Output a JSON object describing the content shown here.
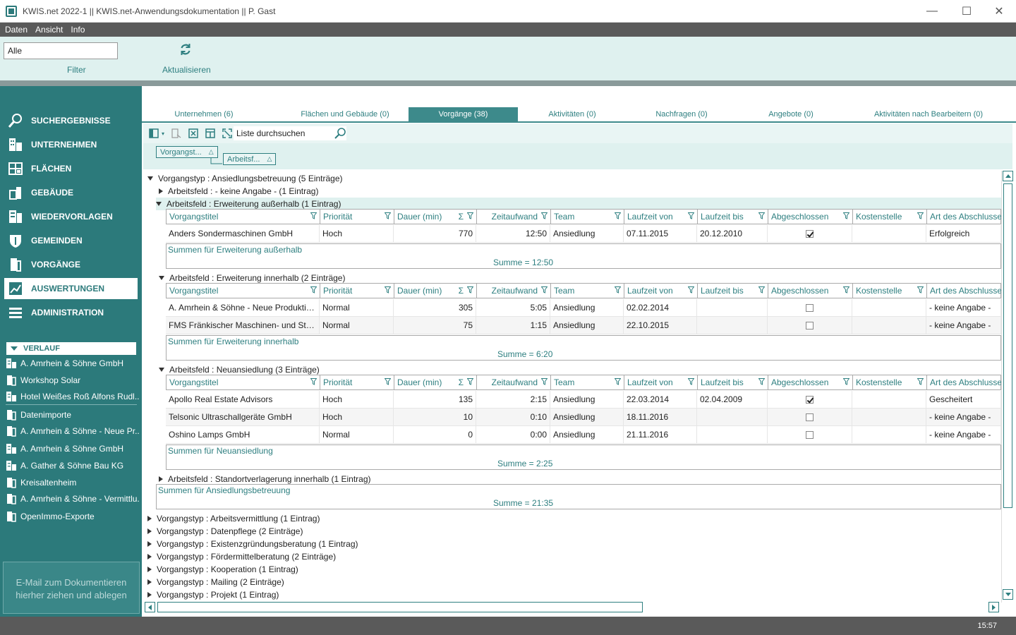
{
  "window": {
    "title": "KWIS.net 2022-1 || KWIS.net-Anwendungsdokumentation || P. Gast"
  },
  "menu": [
    "Daten",
    "Ansicht",
    "Info"
  ],
  "ribbon": {
    "filter_value": "Alle",
    "filter_label": "Filter",
    "refresh_label": "Aktualisieren"
  },
  "nav": [
    {
      "label": "SUCHERGEBNISSE",
      "icon": "search-icon",
      "active": false
    },
    {
      "label": "UNTERNEHMEN",
      "icon": "building-icon",
      "active": false
    },
    {
      "label": "FLÄCHEN",
      "icon": "area-icon",
      "active": false
    },
    {
      "label": "GEBÄUDE",
      "icon": "house-icon",
      "active": false
    },
    {
      "label": "WIEDERVORLAGEN",
      "icon": "calendar-icon",
      "active": false
    },
    {
      "label": "GEMEINDEN",
      "icon": "shield-icon",
      "active": false
    },
    {
      "label": "VORGÄNGE",
      "icon": "folder-icon",
      "active": false
    },
    {
      "label": "AUSWERTUNGEN",
      "icon": "chart-icon",
      "active": true
    },
    {
      "label": "ADMINISTRATION",
      "icon": "settings-icon",
      "active": false
    }
  ],
  "verlauf": {
    "title": "VERLAUF",
    "items": [
      {
        "label": "A. Amrhein & Söhne GmbH",
        "icon": "building-icon"
      },
      {
        "label": "Workshop Solar",
        "icon": "folder-icon"
      },
      {
        "label": "Hotel Weißes Roß Alfons Rudl...",
        "icon": "building-icon"
      },
      {
        "label": "Datenimporte",
        "icon": "folder-icon"
      },
      {
        "label": "A. Amrhein & Söhne - Neue Pr...",
        "icon": "folder-icon"
      },
      {
        "label": "A. Amrhein & Söhne GmbH",
        "icon": "building-icon"
      },
      {
        "label": "A. Gather & Söhne Bau KG",
        "icon": "building-icon"
      },
      {
        "label": "Kreisaltenheim",
        "icon": "folder-icon"
      },
      {
        "label": "A. Amrhein & Söhne - Vermittlu...",
        "icon": "folder-icon"
      },
      {
        "label": "OpenImmo-Exporte",
        "icon": "folder-icon"
      }
    ]
  },
  "dropzone": {
    "line1": "E-Mail  zum Dokumentieren",
    "line2": "hierher ziehen und ablegen"
  },
  "tabs": [
    {
      "label": "Unternehmen (6)"
    },
    {
      "label": "Flächen und Gebäude (0)"
    },
    {
      "label": "Vorgänge (38)"
    },
    {
      "label": "Aktivitäten (0)"
    },
    {
      "label": "Nachfragen (0)"
    },
    {
      "label": "Angebote (0)"
    },
    {
      "label": "Aktivitäten nach Bearbeitern (0)"
    }
  ],
  "active_tab": 2,
  "toolbar": {
    "search_placeholder": "Liste durchsuchen"
  },
  "groupby": [
    "Vorgangst...",
    "Arbeitsf..."
  ],
  "columns": [
    "Vorgangstitel",
    "Priorität",
    "Dauer (min)",
    "Zeitaufwand",
    "Team",
    "Laufzeit von",
    "Laufzeit bis",
    "Abgeschlossen",
    "Kostenstelle",
    "Art des Abschlusses"
  ],
  "grid": {
    "group1": "Vorgangstyp : Ansiedlungsbetreuung (5 Einträge)",
    "sub1": "Arbeitsfeld : - keine Angabe - (1 Eintrag)",
    "sub2": "Arbeitsfeld : Erweiterung außerhalb (1 Eintrag)",
    "sub2_rows": [
      [
        "Anders Sondermaschinen GmbH",
        "Hoch",
        "770",
        "12:50",
        "Ansiedlung",
        "07.11.2015",
        "20.12.2010",
        true,
        "",
        "Erfolgreich"
      ]
    ],
    "sub2_sum_title": "Summen für Erweiterung außerhalb",
    "sub2_sum": "Summe = 12:50",
    "sub3": "Arbeitsfeld : Erweiterung innerhalb (2 Einträge)",
    "sub3_rows": [
      [
        "A. Amrhein & Söhne - Neue Produktionshalle",
        "Normal",
        "305",
        "5:05",
        "Ansiedlung",
        "02.02.2014",
        "",
        false,
        "",
        "- keine Angabe -"
      ],
      [
        "FMS Fränkischer Maschinen- und Stahlbau",
        "Normal",
        "75",
        "1:15",
        "Ansiedlung",
        "22.10.2015",
        "",
        false,
        "",
        "- keine Angabe -"
      ]
    ],
    "sub3_sum_title": "Summen für Erweiterung innerhalb",
    "sub3_sum": "Summe = 6:20",
    "sub4": "Arbeitsfeld : Neuansiedlung (3 Einträge)",
    "sub4_rows": [
      [
        "Apollo Real Estate Advisors",
        "Hoch",
        "135",
        "2:15",
        "Ansiedlung",
        "22.03.2014",
        "02.04.2009",
        true,
        "",
        "Gescheitert"
      ],
      [
        "Telsonic Ultraschallgeräte GmbH",
        "Hoch",
        "10",
        "0:10",
        "Ansiedlung",
        "18.11.2016",
        "",
        false,
        "",
        "- keine Angabe -"
      ],
      [
        "Oshino Lamps GmbH",
        "Normal",
        "0",
        "0:00",
        "Ansiedlung",
        "21.11.2016",
        "",
        false,
        "",
        "- keine Angabe -"
      ]
    ],
    "sub4_sum_title": "Summen für Neuansiedlung",
    "sub4_sum": "Summe = 2:25",
    "sub5": "Arbeitsfeld : Standortverlagerung innerhalb (1 Eintrag)",
    "group1_sum_title": "Summen für Ansiedlungsbetreuung",
    "group1_sum": "Summe = 21:35",
    "other_groups": [
      "Vorgangstyp : Arbeitsvermittlung (1 Eintrag)",
      "Vorgangstyp : Datenpflege (2 Einträge)",
      "Vorgangstyp : Existenzgründungsberatung (1 Eintrag)",
      "Vorgangstyp : Fördermittelberatung (2 Einträge)",
      "Vorgangstyp : Kooperation (1 Eintrag)",
      "Vorgangstyp : Mailing (2 Einträge)",
      "Vorgangstyp : Projekt (1 Eintrag)"
    ]
  },
  "status": {
    "time": "15:57"
  },
  "colors": {
    "accent": "#2c7a7b",
    "light": "#dff1ef"
  }
}
